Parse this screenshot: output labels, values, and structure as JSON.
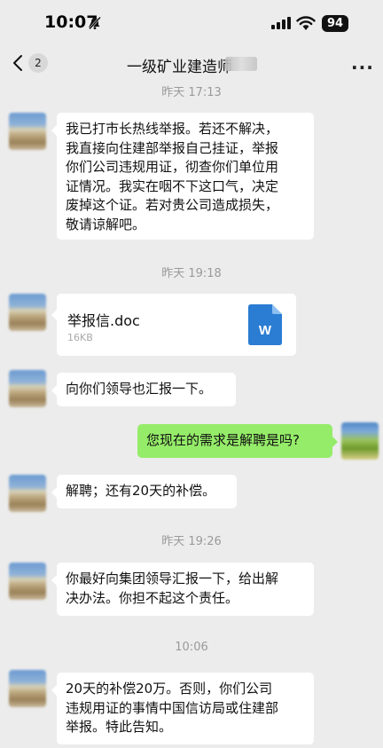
{
  "status": {
    "time": "10:07",
    "battery": "94"
  },
  "nav": {
    "back_count": "2",
    "title": "一级矿业建造师"
  },
  "messages": [
    {
      "type": "time",
      "text": "昨天 17:13"
    },
    {
      "type": "text",
      "side": "left",
      "lines": [
        "我已打市长热线举报。若还不解决，",
        "我直接向住建部举报自己挂证，举报",
        "你们公司违规用证，彻查你们单位用",
        "证情况。我实在咽不下这口气，决定",
        "废掉这个证。若对贵公司造成损失，",
        "敬请谅解吧。"
      ]
    },
    {
      "type": "time",
      "text": "昨天 19:18"
    },
    {
      "type": "file",
      "side": "left",
      "name": "举报信.doc",
      "size": "16KB",
      "icon": "word-file-icon"
    },
    {
      "type": "text",
      "side": "left",
      "lines": [
        "向你们领导也汇报一下。"
      ]
    },
    {
      "type": "text",
      "side": "right",
      "lines": [
        "您现在的需求是解聘是吗?"
      ]
    },
    {
      "type": "text",
      "side": "left",
      "lines": [
        "解聘；还有20天的补偿。"
      ]
    },
    {
      "type": "time",
      "text": "昨天 19:26"
    },
    {
      "type": "text",
      "side": "left",
      "lines": [
        "你最好向集团领导汇报一下，给出解",
        "决办法。你担不起这个责任。"
      ]
    },
    {
      "type": "time",
      "text": "10:06"
    },
    {
      "type": "text",
      "side": "left",
      "lines": [
        "20天的补偿20万。否则，你们公司",
        "违规用证的事情中国信访局或住建部",
        "举报。特此告知。"
      ]
    }
  ],
  "colors": {
    "background": "#ececec",
    "self_bubble": "#95ec69",
    "other_bubble": "#ffffff",
    "word_icon": "#2b7cd3"
  }
}
